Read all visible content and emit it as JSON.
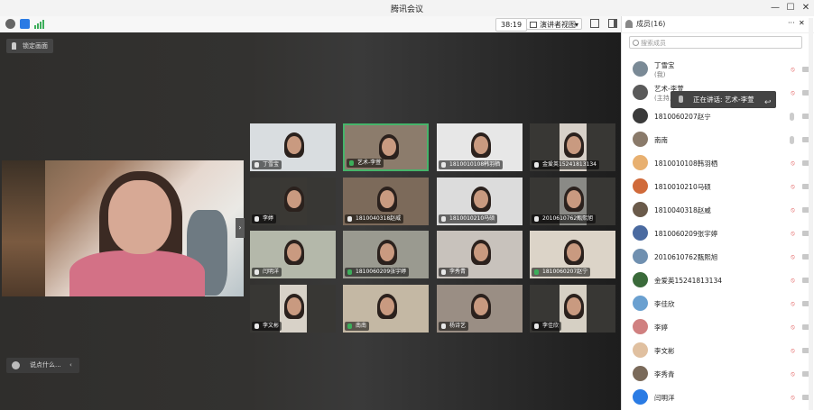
{
  "window": {
    "title": "腾讯会议",
    "minimize": "—",
    "maximize": "☐",
    "close": "✕"
  },
  "toolbar": {
    "timer": "38:19",
    "view_label": "演讲者视图",
    "view_caret": "▾"
  },
  "stage": {
    "lock_label": "锁定画面",
    "chat_placeholder": "说点什么...",
    "chat_toggle": "‹",
    "collapse_arrow": "›"
  },
  "tiles": [
    {
      "name": "丁雪宝",
      "mic": "muted"
    },
    {
      "name": "艺术-李萱",
      "mic": "on",
      "active": true
    },
    {
      "name": "1810010108韩羽栖",
      "mic": "muted"
    },
    {
      "name": "金爱英15241813134",
      "mic": "muted"
    },
    {
      "name": "李婷",
      "mic": "muted"
    },
    {
      "name": "1810040318赵威",
      "mic": "muted"
    },
    {
      "name": "1810010210马硕",
      "mic": "muted"
    },
    {
      "name": "2010610762甄熙旭",
      "mic": "muted"
    },
    {
      "name": "闫明洋",
      "mic": "muted"
    },
    {
      "name": "1810060209张宇婷",
      "mic": "on"
    },
    {
      "name": "李秀青",
      "mic": "muted"
    },
    {
      "name": "1810060207赵宁",
      "mic": "on"
    },
    {
      "name": "李文彬",
      "mic": "muted"
    },
    {
      "name": "南南",
      "mic": "on"
    },
    {
      "name": "杨诗艺",
      "mic": "muted"
    },
    {
      "name": "李佳欣",
      "mic": "muted"
    }
  ],
  "panel": {
    "title": "成员(16)",
    "more": "···",
    "close": "✕",
    "search_placeholder": "搜索成员",
    "speaking_tooltip": "正在讲话: 艺术-李萱",
    "members": [
      {
        "name": "丁雪宝",
        "role": "(我)"
      },
      {
        "name": "艺术-李萱",
        "role": "(主持人)"
      },
      {
        "name": "1810060207赵宁",
        "role": ""
      },
      {
        "name": "南南",
        "role": ""
      },
      {
        "name": "1810010108韩羽栖",
        "role": ""
      },
      {
        "name": "1810010210马硕",
        "role": ""
      },
      {
        "name": "1810040318赵威",
        "role": ""
      },
      {
        "name": "1810060209张宇婷",
        "role": ""
      },
      {
        "name": "2010610762甄熙旭",
        "role": ""
      },
      {
        "name": "金爱英15241813134",
        "role": ""
      },
      {
        "name": "李佳欣",
        "role": ""
      },
      {
        "name": "李婷",
        "role": ""
      },
      {
        "name": "李文彬",
        "role": ""
      },
      {
        "name": "李秀青",
        "role": ""
      },
      {
        "name": "闫明洋",
        "role": ""
      }
    ]
  },
  "colors": {
    "active_border": "#46b46a",
    "muted_icon": "#e05555",
    "avatar_blue": "#2a7be4"
  }
}
